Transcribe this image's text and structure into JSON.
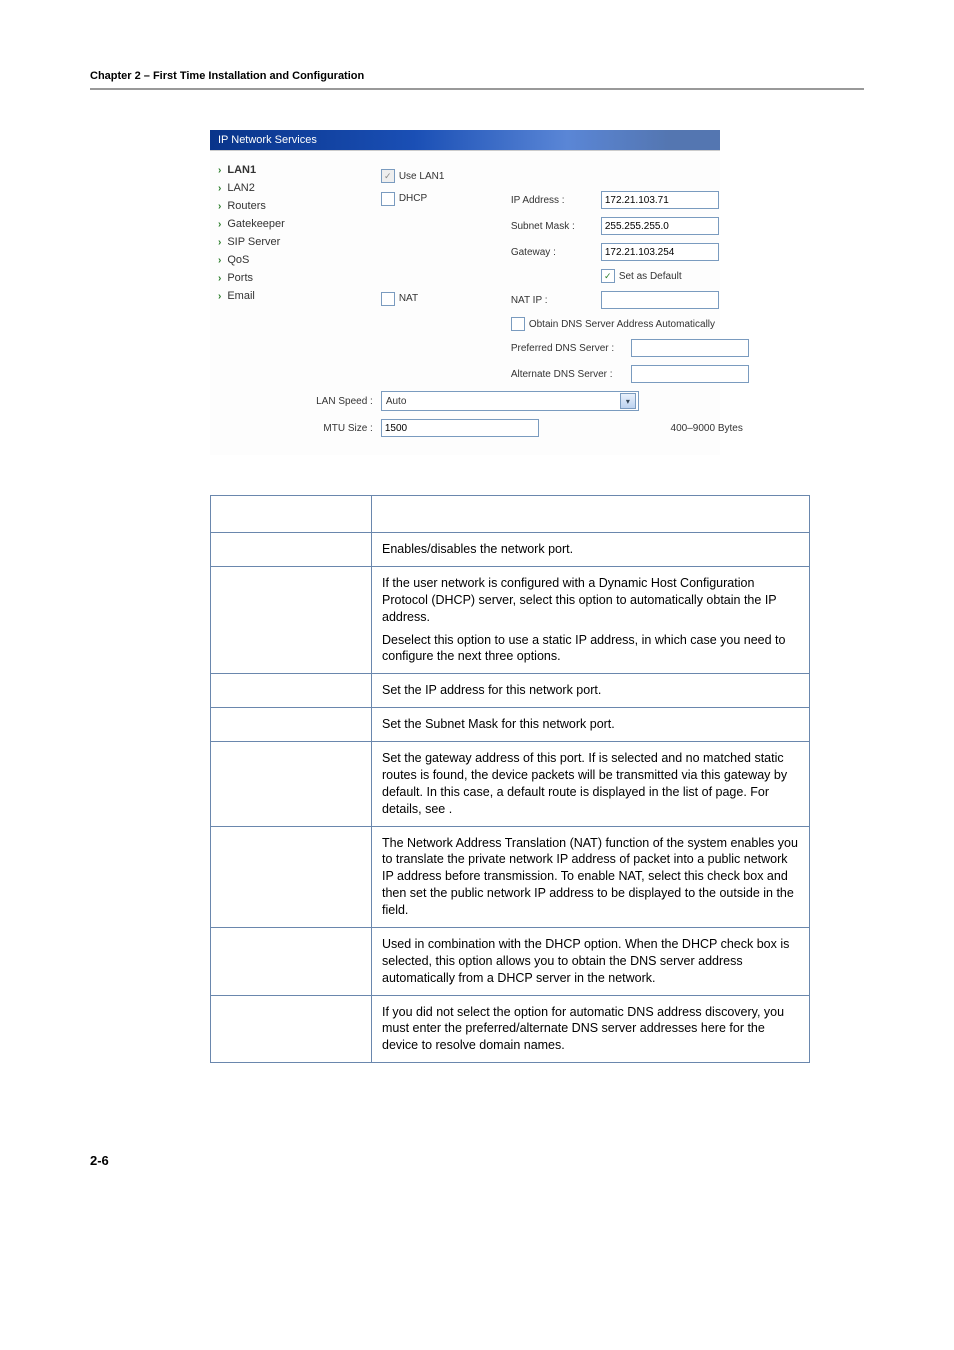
{
  "header": {
    "chapter": "Chapter 2 – First Time Installation and Configuration"
  },
  "screenshot": {
    "title": "IP Network Services",
    "nav": [
      {
        "label": "LAN1",
        "active": true
      },
      {
        "label": "LAN2",
        "active": false
      },
      {
        "label": "Routers",
        "active": false
      },
      {
        "label": "Gatekeeper",
        "active": false
      },
      {
        "label": "SIP Server",
        "active": false
      },
      {
        "label": "QoS",
        "active": false
      },
      {
        "label": "Ports",
        "active": false
      },
      {
        "label": "Email",
        "active": false
      }
    ],
    "form": {
      "use_lan1_label": "Use LAN1",
      "dhcp_label": "DHCP",
      "ip_address_label": "IP Address :",
      "ip_address_value": "172.21.103.71",
      "subnet_mask_label": "Subnet Mask :",
      "subnet_mask_value": "255.255.255.0",
      "gateway_label": "Gateway :",
      "gateway_value": "172.21.103.254",
      "set_as_default_label": "Set as Default",
      "nat_label": "NAT",
      "nat_ip_label": "NAT IP :",
      "nat_ip_value": "",
      "obtain_dns_label": "Obtain DNS Server Address Automatically",
      "preferred_dns_label": "Preferred DNS Server :",
      "preferred_dns_value": "",
      "alternate_dns_label": "Alternate DNS Server :",
      "alternate_dns_value": "",
      "lan_speed_label": "LAN Speed :",
      "lan_speed_value": "Auto",
      "mtu_size_label": "MTU Size :",
      "mtu_size_value": "1500",
      "mtu_hint": "400–9000 Bytes"
    }
  },
  "table": {
    "rows": [
      {
        "desc_p1": "Enables/disables the network port."
      },
      {
        "desc_p1": "If the user network is configured with a Dynamic Host Configuration Protocol (DHCP) server, select this option to automatically obtain the IP address.",
        "desc_p2": "Deselect this option to use a static IP address, in which case you need to configure the next three options."
      },
      {
        "desc_p1": "Set the IP address for this network port."
      },
      {
        "desc_p1": "Set the Subnet Mask for this network port."
      },
      {
        "desc_p1a": "Set the gateway address of this port. If ",
        "desc_p1b": " is selected and no matched static routes is found, the device packets will be transmitted via this gateway by default. In this case, a default route is displayed in the list of ",
        "desc_p1c": " page. For details, see ",
        "desc_p1d": "."
      },
      {
        "desc_p1a": "The Network Address Translation (NAT) function of the system enables you to translate the private network IP address of packet into a public network IP address before transmission. To enable NAT, select this check box and then set the public network IP address to be displayed to the outside in the ",
        "desc_p1b": " field."
      },
      {
        "desc_p1": "Used in combination with the DHCP option. When the DHCP check box is selected, this option allows you to obtain the DNS server address automatically from a DHCP server in the network."
      },
      {
        "desc_p1": "If you did not select the option for automatic DNS address discovery, you must enter the preferred/alternate DNS server addresses here for the device to resolve domain names."
      }
    ]
  },
  "footer": {
    "pagenum": "2-6"
  }
}
